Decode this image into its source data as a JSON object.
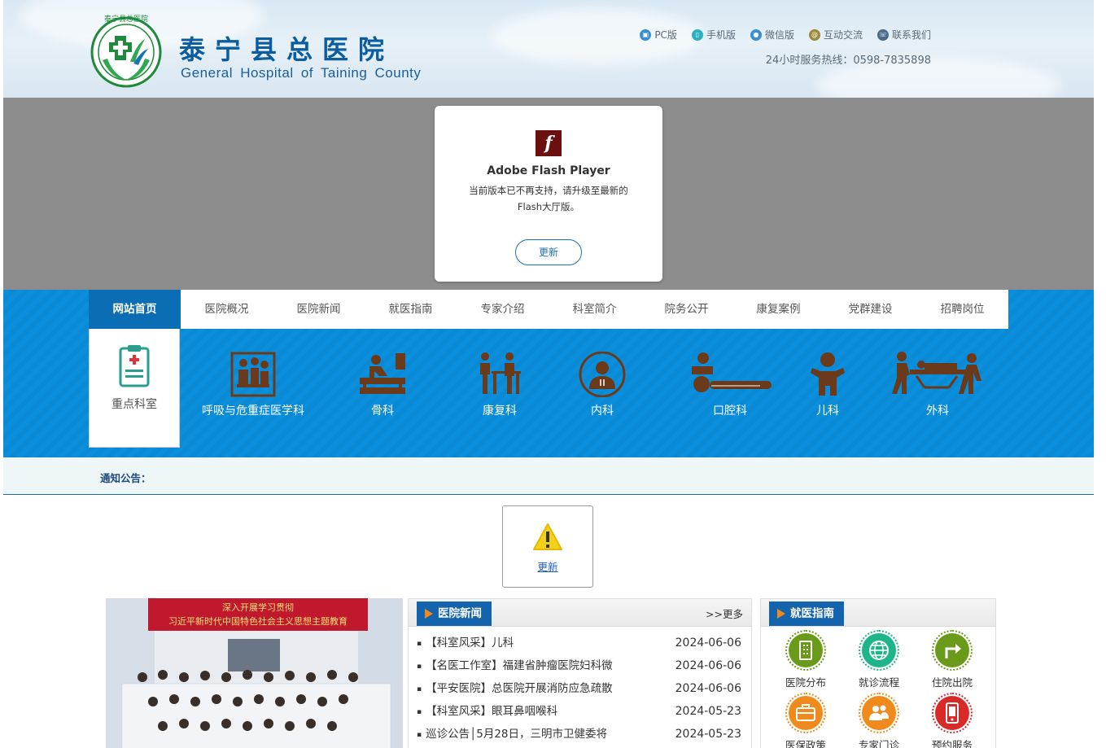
{
  "header": {
    "logo_cn": "泰宁县总医院",
    "logo_en": "General Hospital of Taining County",
    "emblem_text": "泰宁县总医院",
    "top_links": [
      {
        "label": "PC版",
        "icon": "monitor-icon",
        "color": "#3a8fd0"
      },
      {
        "label": "手机版",
        "icon": "mobile-icon",
        "color": "#2bb0c2"
      },
      {
        "label": "微信版",
        "icon": "wechat-icon",
        "color": "#3a8fd0"
      },
      {
        "label": "互动交流",
        "icon": "chat-icon",
        "color": "#9a8a3a"
      },
      {
        "label": "联系我们",
        "icon": "phone-icon",
        "color": "#4a6a8a"
      }
    ],
    "hotline": "24小时服务热线：0598-7835898"
  },
  "flash": {
    "logo_glyph": "f",
    "title": "Adobe Flash Player",
    "message": "当前版本已不再支持，请升级至最新的Flash大厅版。",
    "update_label": "更新"
  },
  "nav": {
    "items": [
      "网站首页",
      "医院概况",
      "医院新闻",
      "就医指南",
      "专家介绍",
      "科室简介",
      "院务公开",
      "康复案例",
      "党群建设",
      "招聘岗位"
    ],
    "active_index": 0
  },
  "departments": {
    "key_label": "重点科室",
    "items": [
      "呼吸与危重症医学科",
      "骨科",
      "康复科",
      "内科",
      "口腔科",
      "儿科",
      "外科"
    ]
  },
  "notice": {
    "label": "通知公告："
  },
  "plugin": {
    "update_label": "更新"
  },
  "photo": {
    "banner_line1": "深入开展学习贯彻",
    "banner_line2": "习近平新时代中国特色社会主义思想主题教育"
  },
  "news": {
    "title": "医院新闻",
    "more_label": ">>更多",
    "rows": [
      {
        "title": "【科室风采】儿科",
        "date": "2024-06-06"
      },
      {
        "title": "【名医工作室】福建省肿瘤医院妇科微",
        "date": "2024-06-06"
      },
      {
        "title": "【平安医院】总医院开展消防应急疏散",
        "date": "2024-06-06"
      },
      {
        "title": "【科室风采】眼耳鼻咽喉科",
        "date": "2024-05-23"
      },
      {
        "title": "巡诊公告│5月28日，三明市卫健委将",
        "date": "2024-05-23"
      }
    ]
  },
  "guide": {
    "title": "就医指南",
    "items": [
      {
        "label": "医院分布",
        "icon": "building-icon",
        "color": "#6a9a1a"
      },
      {
        "label": "就诊流程",
        "icon": "globe-icon",
        "color": "#1fb58a"
      },
      {
        "label": "住院出院",
        "icon": "arrow-turn-icon",
        "color": "#6a9a1a"
      },
      {
        "label": "医保政策",
        "icon": "briefcase-icon",
        "color": "#f08a1c"
      },
      {
        "label": "专家门诊",
        "icon": "users-icon",
        "color": "#f08a1c"
      },
      {
        "label": "预约服务",
        "icon": "mobile-icon",
        "color": "#d92a2a"
      }
    ]
  }
}
